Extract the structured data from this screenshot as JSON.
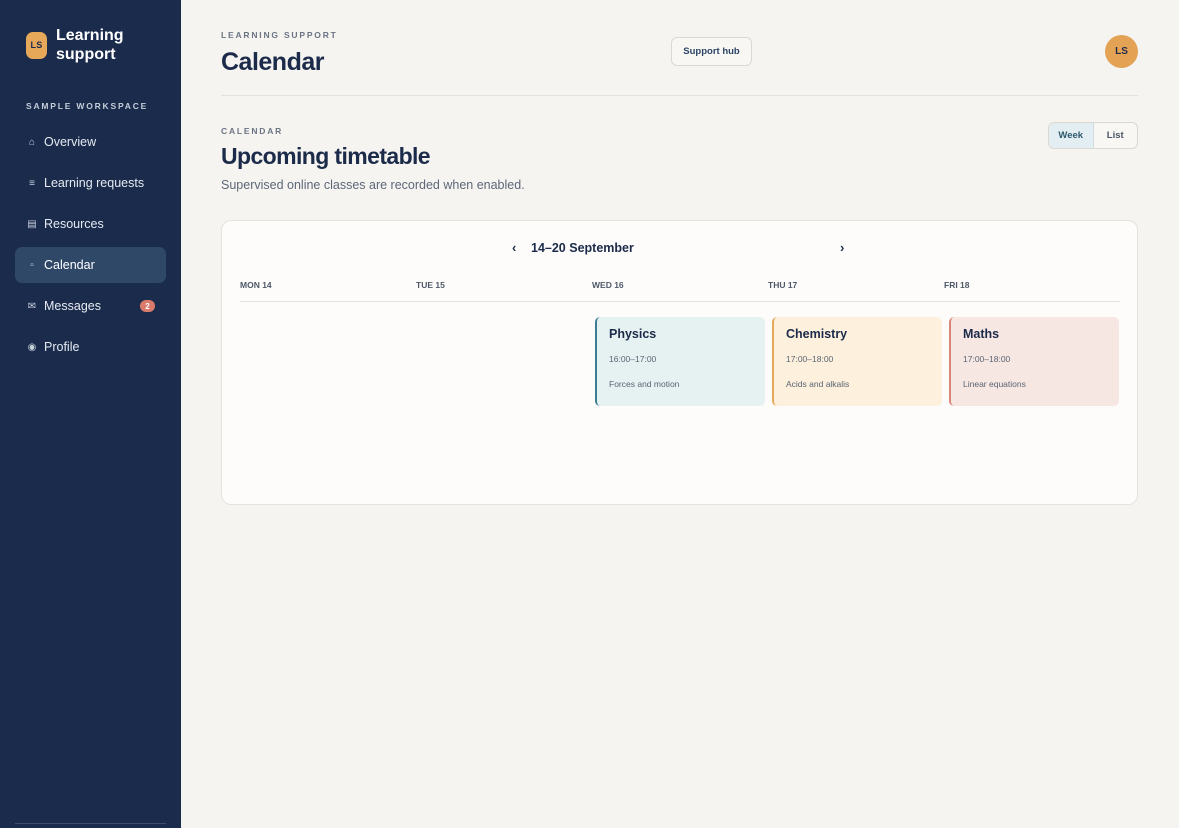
{
  "sidebar": {
    "logo_initials": "LS",
    "brand_title": "Learning support",
    "workspace_label": "SAMPLE WORKSPACE",
    "items": [
      {
        "label": "Overview",
        "icon": "home-icon",
        "glyph": "⌂"
      },
      {
        "label": "Learning requests",
        "icon": "list-icon",
        "glyph": "≡"
      },
      {
        "label": "Resources",
        "icon": "book-icon",
        "glyph": "▤"
      },
      {
        "label": "Calendar",
        "icon": "calendar-icon",
        "glyph": "▫",
        "active": true
      },
      {
        "label": "Messages",
        "icon": "mail-icon",
        "glyph": "✉",
        "badge": "2"
      },
      {
        "label": "Profile",
        "icon": "profile-icon",
        "glyph": "◉"
      }
    ]
  },
  "header": {
    "eyebrow": "LEARNING SUPPORT",
    "title": "Calendar",
    "support_button": "Support hub",
    "avatar_initials": "LS"
  },
  "section": {
    "eyebrow": "CALENDAR",
    "title": "Upcoming timetable",
    "subtitle": "Supervised online classes are recorded when enabled.",
    "view_toggle": {
      "week": "Week",
      "list": "List",
      "selected": "Week"
    }
  },
  "calendar": {
    "prev_glyph": "‹",
    "next_glyph": "›",
    "range": "14–20 September",
    "days": [
      "MON 14",
      "TUE 15",
      "WED 16",
      "THU 17",
      "FRI 18"
    ],
    "events": [
      {
        "title": "Physics",
        "time": "16:00–17:00",
        "desc": "Forces and motion",
        "accent": "#3a7c93"
      },
      {
        "title": "Chemistry",
        "time": "17:00–18:00",
        "desc": "Acids and alkalis",
        "accent": "#e7a85a"
      },
      {
        "title": "Maths",
        "time": "17:00–18:00",
        "desc": "Linear equations",
        "accent": "#d98577"
      }
    ]
  },
  "colors": {
    "sidebar_bg": "#1a2b4c",
    "accent_orange": "#e3a254",
    "page_bg": "#f5f4f0"
  }
}
